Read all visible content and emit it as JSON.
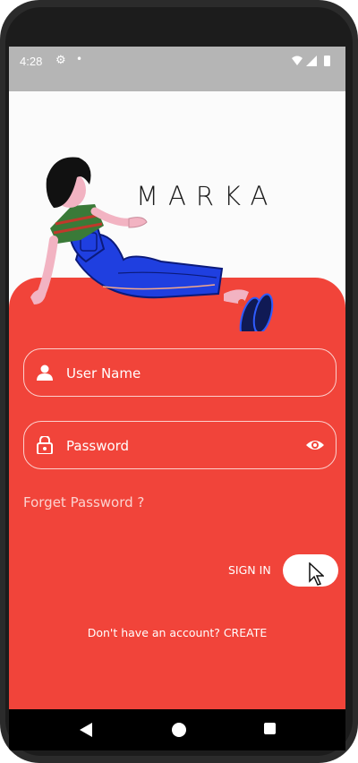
{
  "status_bar": {
    "time": "4:28",
    "icons": [
      "gear-icon",
      "dot-icon",
      "wifi-icon",
      "signal-icon",
      "battery-icon"
    ]
  },
  "app": {
    "logo_text": "MARKA",
    "username": {
      "placeholder": "User Name",
      "icon": "person-icon"
    },
    "password": {
      "placeholder": "Password",
      "icon": "lock-icon",
      "toggle_icon": "eye-icon"
    },
    "forget_password": "Forget Password ?",
    "sign_in_label": "SIGN IN",
    "create_account": "Don't have an account? CREATE"
  },
  "navigation": {
    "items": [
      "back-icon",
      "home-icon",
      "recent-apps-icon"
    ]
  },
  "colors": {
    "primary": "#f1443a",
    "status_bar": "#b5b5b5",
    "background": "#fbfbfb"
  }
}
